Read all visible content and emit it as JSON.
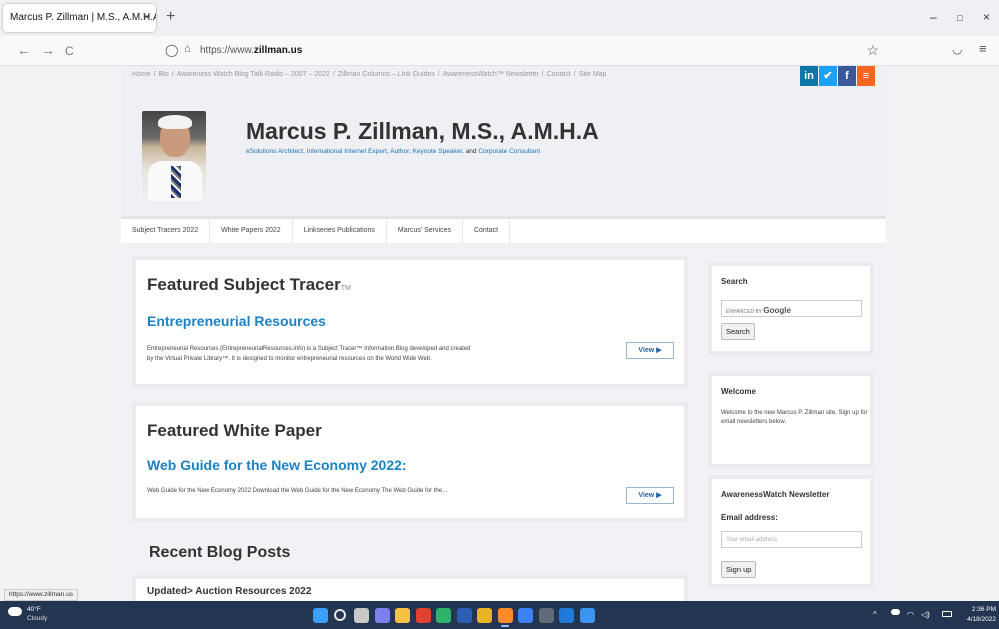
{
  "browser": {
    "tab_title": "Marcus P. Zillman | M.S., A.M.H.A. | |",
    "tab_close": "×",
    "new_tab": "+",
    "window": {
      "minimize": "–",
      "restore": "□",
      "close": "×"
    },
    "nav": {
      "back": "←",
      "forward": "→",
      "reload": "C"
    },
    "url_prefix": "https://www.",
    "url_domain": "zillman.us",
    "status_url": "https://www.zillman.us"
  },
  "site": {
    "breadcrumb": [
      "Home",
      "/",
      "Bio",
      "/",
      "Awareness Watch Blog Talk Radio – 2007 – 2022",
      "/",
      "Zillman Columns – Link Guides",
      "/",
      "AwarenessWatch™ Newsletter",
      "/",
      "Contact",
      "/",
      "Site Map"
    ],
    "social": [
      {
        "label": "in",
        "color": "#0e76a8"
      },
      {
        "label": "✔",
        "color": "#1da1f2"
      },
      {
        "label": "f",
        "color": "#3b5998"
      },
      {
        "label": "≡",
        "color": "#f26522"
      }
    ],
    "title": "Marcus P. Zillman, M.S., A.M.H.A",
    "tagline_1": "eSolutions Architect, International Internet Expert, Author, Keynote Speaker,",
    "tagline_and": " and ",
    "tagline_2": "Corporate Consultant",
    "nav": [
      "Subject Tracers 2022",
      "White Papers 2022",
      "Linkseries Publications",
      "Marcus' Services",
      "Contact"
    ]
  },
  "featured_tracer": {
    "heading": "Featured Subject Tracer",
    "tm": "TM",
    "subtitle": "Entrepreneurial Resources",
    "text_1": "Entrepreneurial Resources (EntrepreneurialResources.info) is a Subject Tracer™ Information Blog developed and created",
    "text_2": "by the Virtual Private Library™. It is designed to monitor entrepreneurial resources on the World Wide Web.",
    "button": "View ▶"
  },
  "featured_paper": {
    "heading": "Featured White Paper",
    "subtitle": "Web Guide for the New Economy 2022:",
    "text": "Web Guide for the New Economy 2022 Download the Web Guide for the New Economy The Web Guide for the…",
    "button": "View ▶"
  },
  "recent_posts": {
    "heading": "Recent Blog Posts",
    "first_post": "Updated> Auction Resources 2022"
  },
  "sidebar": {
    "search": {
      "heading": "Search",
      "enhanced": "ENHANCED BY ",
      "google": "Google",
      "button": "Search"
    },
    "welcome": {
      "heading": "Welcome",
      "text": "Welcome to the new Marcus P. Zillman site. Sign up for email newsletters below."
    },
    "newsletter": {
      "heading": "AwarenessWatch Newsletter",
      "email_label": "Email address:",
      "placeholder": "Your email address",
      "button": "Sign up"
    }
  },
  "taskbar": {
    "temp": "40°F",
    "condition": "Cloudy",
    "time": "2:36 PM",
    "date": "4/18/2022",
    "tray_chevron": "^",
    "tray_wifi": "◠",
    "tray_sound": "◁)",
    "apps": [
      {
        "name": "start",
        "color": "#3aa0ff"
      },
      {
        "name": "search",
        "color": "#e6e6e6"
      },
      {
        "name": "task-view",
        "color": "#c8c8c8"
      },
      {
        "name": "chat",
        "color": "#7b7ff0"
      },
      {
        "name": "file-explorer",
        "color": "#f5c142"
      },
      {
        "name": "office",
        "color": "#e0422f"
      },
      {
        "name": "edge",
        "color": "#2fb26b"
      },
      {
        "name": "word",
        "color": "#2b5fb4"
      },
      {
        "name": "chrome",
        "color": "#e7b423"
      },
      {
        "name": "firefox",
        "color": "#ff8a2a"
      },
      {
        "name": "calendar",
        "color": "#3b82f6"
      },
      {
        "name": "dell",
        "color": "#606a78"
      },
      {
        "name": "outlook",
        "color": "#1f7ad8"
      },
      {
        "name": "todo",
        "color": "#3a96f2"
      }
    ]
  }
}
